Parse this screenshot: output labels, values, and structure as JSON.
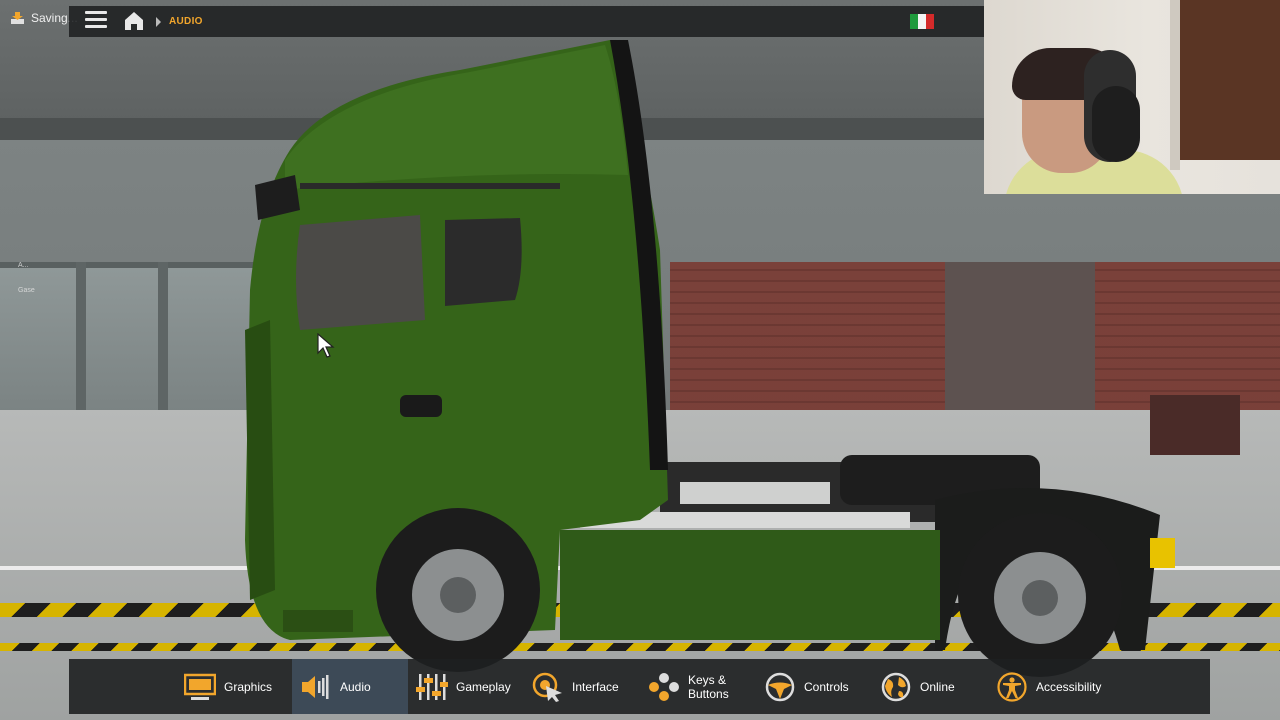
{
  "topbar": {
    "saving_text": "Saving...",
    "breadcrumb": "AUDIO",
    "accent_color": "#f2a62c"
  },
  "icons": {
    "save": "save-icon",
    "menu": "hamburger-menu-icon",
    "home": "home-icon",
    "flag": "italy-flag-icon"
  },
  "background_labels": [
    "A...",
    "Gase"
  ],
  "tabs": [
    {
      "label": "Graphics",
      "icon": "monitor-icon",
      "active": false
    },
    {
      "label": "Audio",
      "icon": "speaker-icon",
      "active": true
    },
    {
      "label": "Gameplay",
      "icon": "sliders-icon",
      "active": false
    },
    {
      "label": "Interface",
      "icon": "pointer-icon",
      "active": false
    },
    {
      "label": "Keys &\nButtons",
      "icon": "keys-icon",
      "active": false
    },
    {
      "label": "Controls",
      "icon": "steering-wheel-icon",
      "active": false
    },
    {
      "label": "Online",
      "icon": "globe-icon",
      "active": false
    },
    {
      "label": "Accessibility",
      "icon": "accessibility-icon",
      "active": false
    }
  ]
}
